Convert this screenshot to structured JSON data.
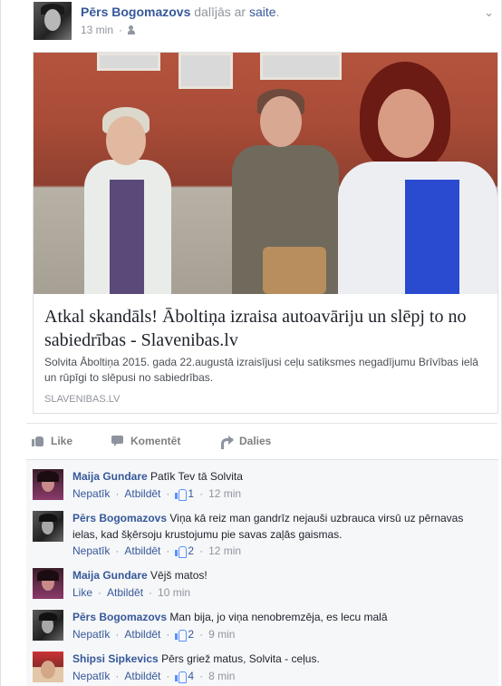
{
  "post": {
    "author": "Pērs Bogomazovs",
    "shared_text": "dalījās ar",
    "shared_link": "saite",
    "time": "13 min",
    "privacy_icon": "friends-icon",
    "menu_icon": "chevron-down-icon"
  },
  "link_card": {
    "title": "Atkal skandāls! Āboltiņa izraisa autoavāriju un slēpj to no sabiedrības - Slavenibas.lv",
    "description": "Solvita Āboltiņa 2015. gada 22.augustā izraisījusi ceļu satiksmes negadījumu Brīvības ielā un rūpīgi to slēpusi no sabiedrības.",
    "domain": "SLAVENIBAS.LV"
  },
  "actions": {
    "like": "Like",
    "comment": "Komentēt",
    "share": "Dalies"
  },
  "comments": [
    {
      "name": "Maija Gundare",
      "text": "Patīk Tev tā Solvita",
      "unlike": "Nepatīk",
      "reply": "Atbildēt",
      "likes": "1",
      "time": "12 min",
      "avatar": "female"
    },
    {
      "name": "Pērs Bogomazovs",
      "text": "Viņa kā reiz man gandrīz nejauši uzbrauca virsū uz pērnavas ielas, kad šķērsoju krustojumu pie savas zaļās gaismas.",
      "unlike": "Nepatīk",
      "reply": "Atbildēt",
      "likes": "2",
      "time": "12 min",
      "avatar": "male"
    },
    {
      "name": "Maija Gundare",
      "text": "Vējš matos!",
      "unlike": "Like",
      "reply": "Atbildēt",
      "likes": "",
      "time": "10 min",
      "avatar": "female"
    },
    {
      "name": "Pērs Bogomazovs",
      "text": "Man bija, jo viņa nenobremzēja, es lecu malā",
      "unlike": "Nepatīk",
      "reply": "Atbildēt",
      "likes": "2",
      "time": "9 min",
      "avatar": "male"
    },
    {
      "name": "Shipsi Sipkevics",
      "text": "Pērs griež matus, Solvita - ceļus.",
      "unlike": "Nepatīk",
      "reply": "Atbildēt",
      "likes": "4",
      "time": "8 min",
      "avatar": "other"
    }
  ]
}
